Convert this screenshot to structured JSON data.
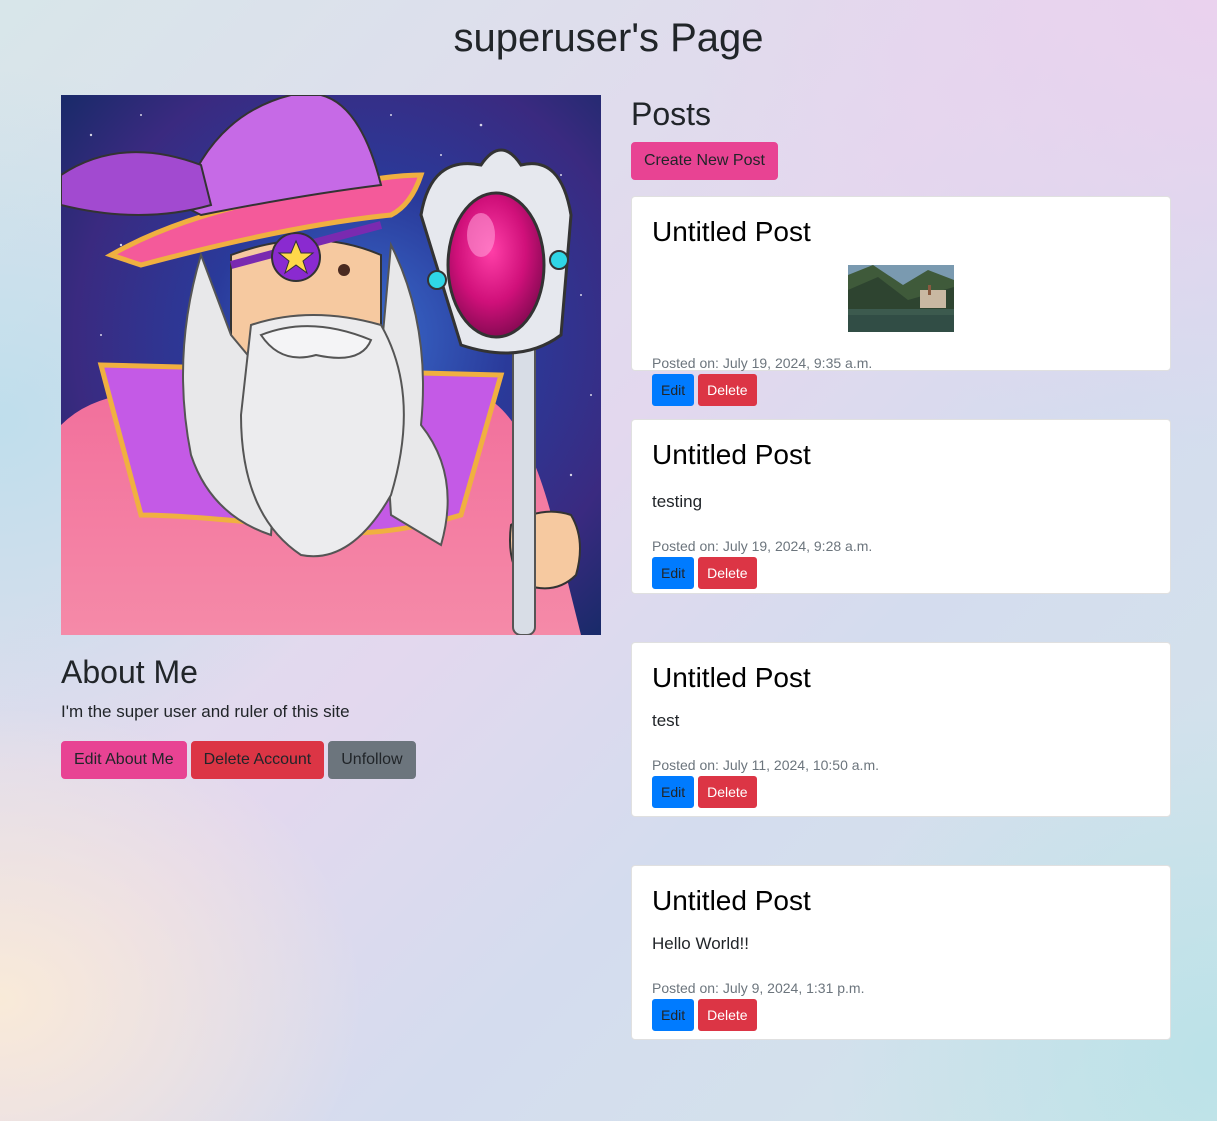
{
  "page": {
    "title": "superuser's Page"
  },
  "profile": {
    "avatar_alt": "wizard avatar",
    "about_title": "About Me",
    "about_text": "I'm the super user and ruler of this site",
    "buttons": {
      "edit_about": "Edit About Me",
      "delete_account": "Delete Account",
      "unfollow": "Unfollow"
    }
  },
  "posts": {
    "title": "Posts",
    "create_label": "Create New Post",
    "items": [
      {
        "title": "Untitled Post",
        "body": "",
        "has_image": true,
        "meta": "Posted on: July 19, 2024, 9:35 a.m.",
        "edit_label": "Edit",
        "delete_label": "Delete"
      },
      {
        "title": "Untitled Post",
        "body": "testing",
        "has_image": false,
        "meta": "Posted on: July 19, 2024, 9:28 a.m.",
        "edit_label": "Edit",
        "delete_label": "Delete"
      },
      {
        "title": "Untitled Post",
        "body": "test",
        "has_image": false,
        "meta": "Posted on: July 11, 2024, 10:50 a.m.",
        "edit_label": "Edit",
        "delete_label": "Delete"
      },
      {
        "title": "Untitled Post",
        "body": "Hello World!!",
        "has_image": false,
        "meta": "Posted on: July 9, 2024, 1:31 p.m.",
        "edit_label": "Edit",
        "delete_label": "Delete"
      }
    ]
  },
  "colors": {
    "primary_pink": "#e84393",
    "danger_red": "#dc3545",
    "secondary_gray": "#6c757d",
    "edit_blue": "#007bff"
  }
}
